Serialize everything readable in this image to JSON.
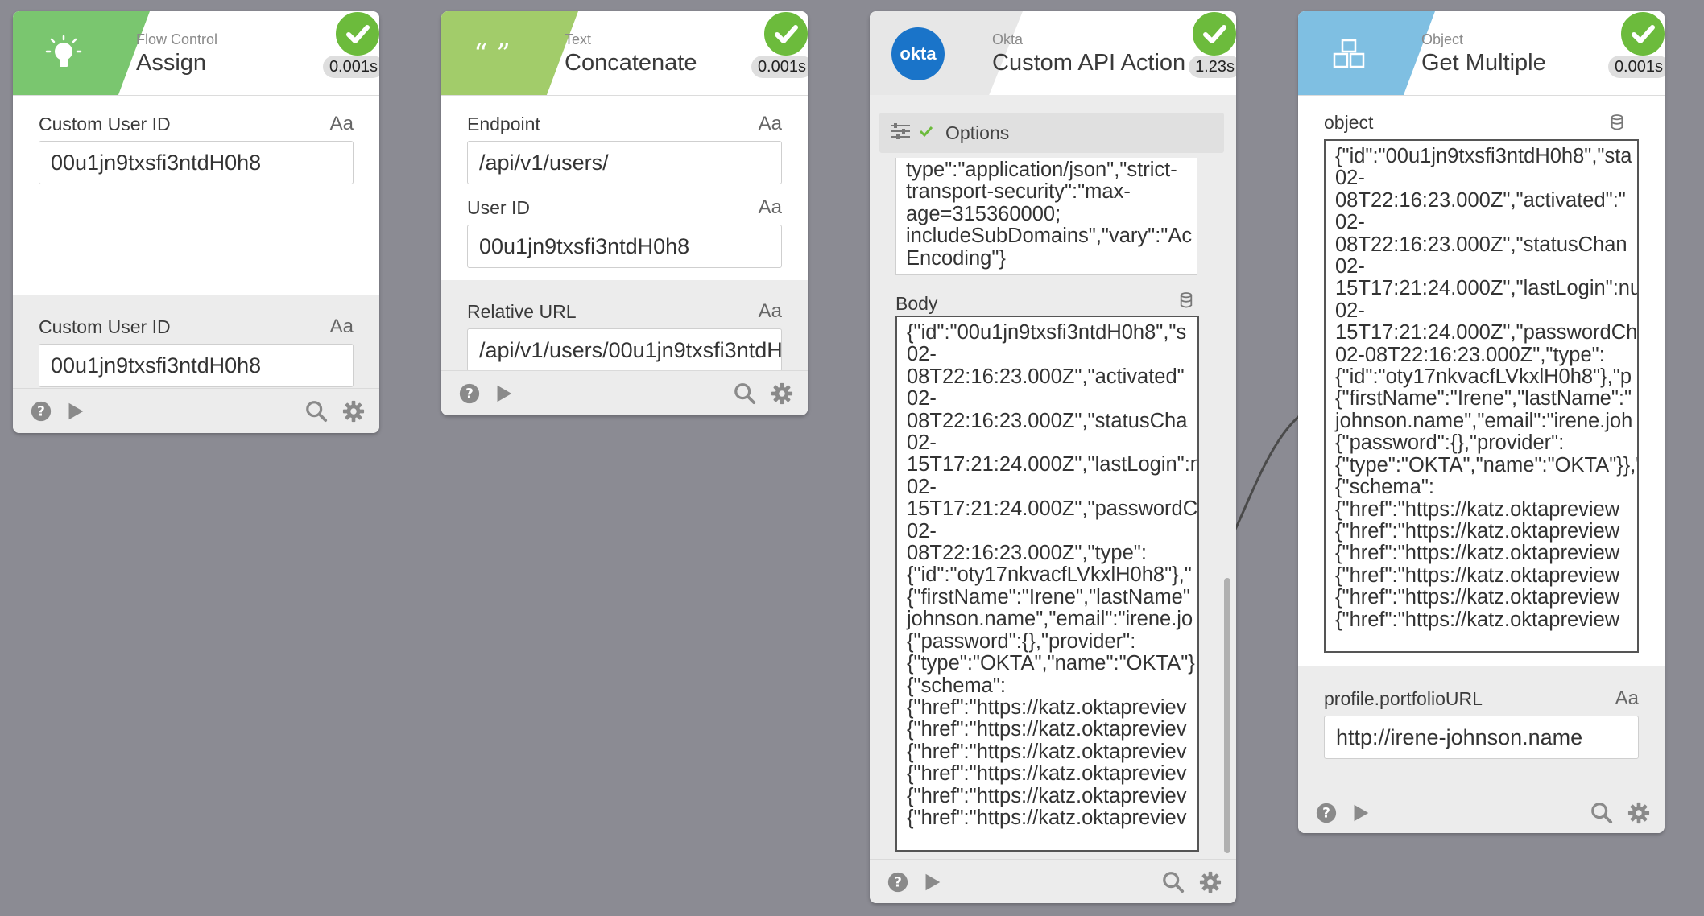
{
  "colors": {
    "flow_control": "#7ac66f",
    "text": "#a2cc6a",
    "okta_blue": "#1a74c9",
    "object": "#7fbfe2",
    "success": "#6cbb3c",
    "canvas": "#8b8b93"
  },
  "cards": [
    {
      "app": "Flow Control",
      "action": "Assign",
      "icon": "lightbulb-icon",
      "timing": "0.001s",
      "inputs": [
        {
          "label": "Custom User ID",
          "type_icon": "Aa",
          "value": "00u1jn9txsfi3ntdH0h8"
        }
      ],
      "outputs": [
        {
          "label": "Custom User ID",
          "type_icon": "Aa",
          "value": "00u1jn9txsfi3ntdH0h8"
        }
      ]
    },
    {
      "app": "Text",
      "action": "Concatenate",
      "icon": "quote-icon",
      "timing": "0.001s",
      "inputs": [
        {
          "label": "Endpoint",
          "type_icon": "Aa",
          "value": "/api/v1/users/"
        },
        {
          "label": "User ID",
          "type_icon": "Aa",
          "value": "00u1jn9txsfi3ntdH0h8"
        }
      ],
      "outputs": [
        {
          "label": "Relative URL",
          "type_icon": "Aa",
          "value": "/api/v1/users/00u1jn9txsfi3ntdH"
        }
      ]
    },
    {
      "app": "Okta",
      "action": "Custom API Action",
      "icon_text": "okta",
      "timing": "1.23s",
      "options_label": "Options",
      "headers_text": "type\":\"application/json\",\"strict-\ntransport-security\":\"max-\nage=315360000;\nincludeSubDomains\",\"vary\":\"Ac\nEncoding\"}",
      "body_label": "Body",
      "body_text": "{\"id\":\"00u1jn9txsfi3ntdH0h8\",\"s\n02-\n08T22:16:23.000Z\",\"activated\"\n02-\n08T22:16:23.000Z\",\"statusCha\n02-\n15T17:21:24.000Z\",\"lastLogin\":n\n02-\n15T17:21:24.000Z\",\"passwordC\n02-\n08T22:16:23.000Z\",\"type\":\n{\"id\":\"oty17nkvacfLVkxlH0h8\"},\"\n{\"firstName\":\"Irene\",\"lastName\"\njohnson.name\",\"email\":\"irene.jo\n{\"password\":{},\"provider\":\n{\"type\":\"OKTA\",\"name\":\"OKTA\"}\n{\"schema\":\n{\"href\":\"https://katz.oktapreviev\n{\"href\":\"https://katz.oktapreviev\n{\"href\":\"https://katz.oktapreviev\n{\"href\":\"https://katz.oktapreviev\n{\"href\":\"https://katz.oktapreviev\n{\"href\":\"https://katz.oktapreviev"
    },
    {
      "app": "Object",
      "action": "Get Multiple",
      "icon": "cubes-icon",
      "timing": "0.001s",
      "object_label": "object",
      "object_text": "{\"id\":\"00u1jn9txsfi3ntdH0h8\",\"sta\n02-\n08T22:16:23.000Z\",\"activated\":\"\n02-\n08T22:16:23.000Z\",\"statusChan\n02-\n15T17:21:24.000Z\",\"lastLogin\":nu\n02-\n15T17:21:24.000Z\",\"passwordCh\n02-08T22:16:23.000Z\",\"type\":\n{\"id\":\"oty17nkvacfLVkxlH0h8\"},\"p\n{\"firstName\":\"Irene\",\"lastName\":\"\njohnson.name\",\"email\":\"irene.joh\n{\"password\":{},\"provider\":\n{\"type\":\"OKTA\",\"name\":\"OKTA\"}},\"\n{\"schema\":\n{\"href\":\"https://katz.oktapreview\n{\"href\":\"https://katz.oktapreview\n{\"href\":\"https://katz.oktapreview\n{\"href\":\"https://katz.oktapreview\n{\"href\":\"https://katz.oktapreview\n{\"href\":\"https://katz.oktapreview",
      "outputs": [
        {
          "label": "profile.portfolioURL",
          "type_icon": "Aa",
          "value": "http://irene-johnson.name"
        }
      ]
    }
  ]
}
